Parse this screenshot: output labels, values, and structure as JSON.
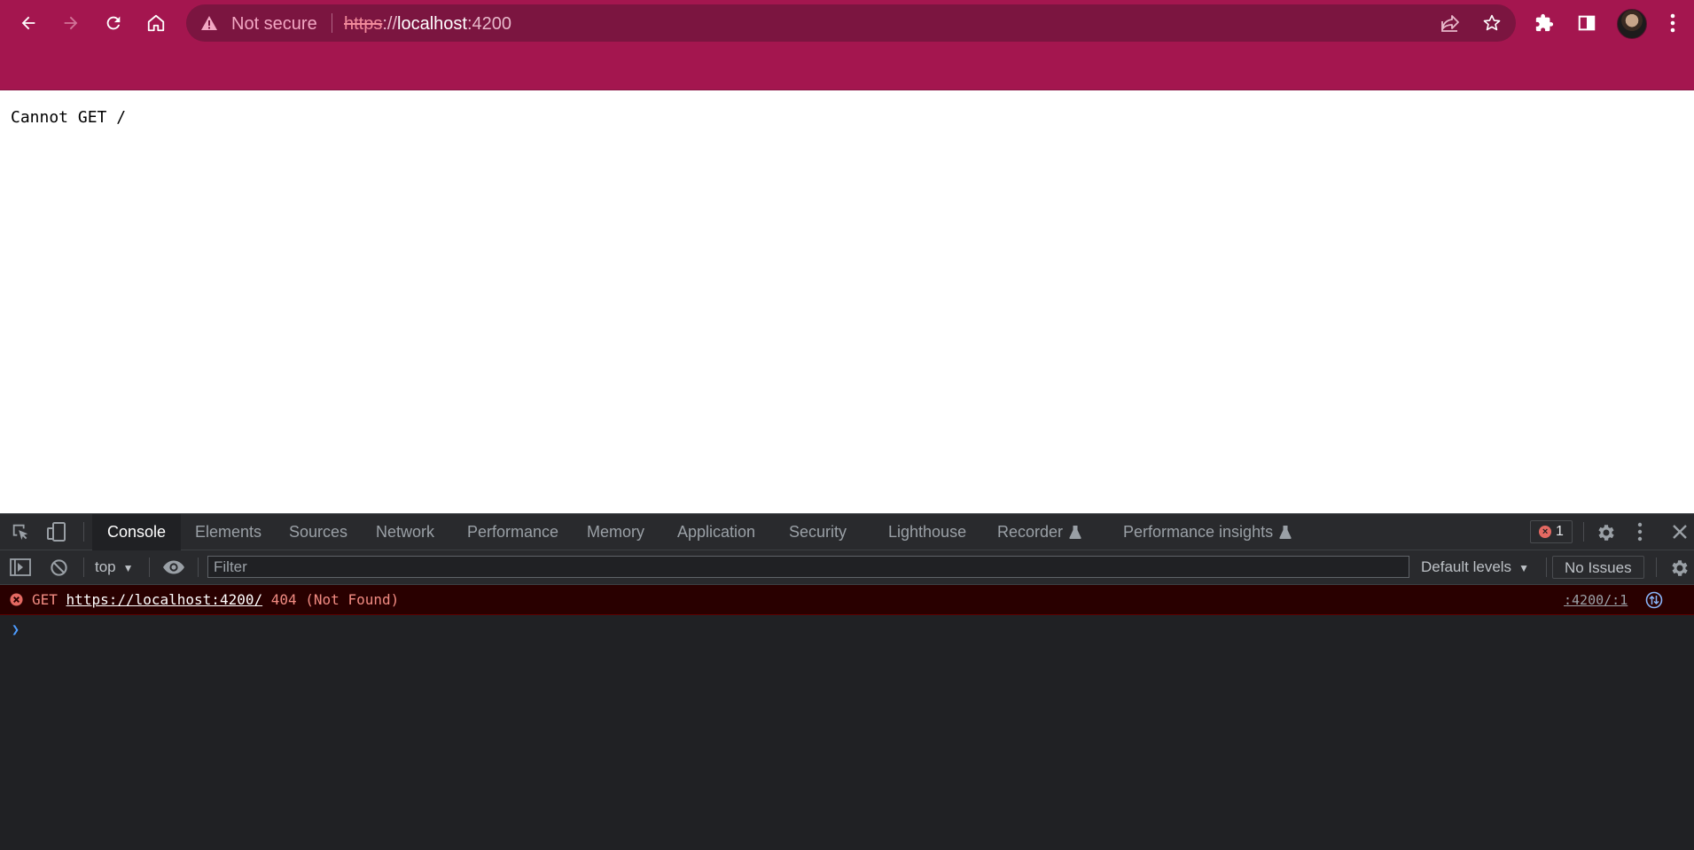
{
  "browser": {
    "security_label": "Not secure",
    "url": {
      "scheme": "https",
      "separator": "://",
      "host": "localhost",
      "port": ":4200"
    },
    "colors": {
      "frame": "#a4164f",
      "omnibox": "#7b1540"
    }
  },
  "page": {
    "text": "Cannot GET /"
  },
  "devtools": {
    "tabs": [
      {
        "label": "Console",
        "active": true
      },
      {
        "label": "Elements"
      },
      {
        "label": "Sources"
      },
      {
        "label": "Network"
      },
      {
        "label": "Performance"
      },
      {
        "label": "Memory"
      },
      {
        "label": "Application"
      },
      {
        "label": "Security"
      },
      {
        "label": "Lighthouse"
      },
      {
        "label": "Recorder",
        "icon": "flask-icon"
      },
      {
        "label": "Performance insights",
        "icon": "flask-icon"
      }
    ],
    "error_count": "1",
    "context": "top",
    "filter_placeholder": "Filter",
    "levels_label": "Default levels",
    "issues_label": "No Issues",
    "messages": [
      {
        "level": "error",
        "method": "GET",
        "url": "https://localhost:4200/",
        "status": "404 (Not Found)",
        "source": ":4200/:1"
      }
    ],
    "colors": {
      "error_bg": "#290000",
      "error_text": "#f28b82",
      "prompt": "#4d9cff"
    }
  }
}
